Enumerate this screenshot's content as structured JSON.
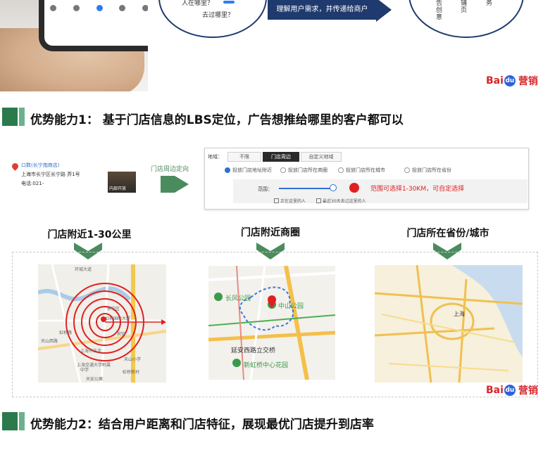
{
  "hero": {
    "bubble_left_line1": "人在哪里？",
    "bubble_left_line2": "去过哪里？",
    "arrow_text": "理解用户需求，并传递给商户",
    "bubble_right_cols": [
      "告创意",
      "铺页",
      "务"
    ]
  },
  "brand": {
    "part1": "Bai",
    "paw": "du",
    "part2": "营销"
  },
  "section1": {
    "title": "优势能力1： 基于门店信息的LBS定位，广告想推给哪里的客户都可以"
  },
  "store": {
    "name": "口数(长宁炮商店)",
    "address": "上海市长宁区长宁路      弄1号",
    "phone": "电话:021-",
    "photo_caption": "内部开放",
    "flow_label": "门店周边定向"
  },
  "panel": {
    "region_label": "地域：",
    "tabs": [
      "不限",
      "门店周边",
      "自定义地域"
    ],
    "radios": [
      "投放门店地址附近",
      "投放门店所在商圈",
      "投放门店所在城市",
      "投放门店所在省份"
    ],
    "range_label": "范围：",
    "range_note": "范围可选择1-30KM，可自定选择",
    "checks": [
      "正在这里的人",
      "最近30天去过这里的人"
    ]
  },
  "captions": [
    "门店附近1-30公里",
    "门店附近商圈",
    "门店所在省份/城市"
  ],
  "map1": {
    "labels": [
      "环城大道",
      "虹桥国际大厦",
      "长宁区",
      "宾馆",
      "上海市古北",
      "天山西路",
      "虹桥路",
      "天山小学",
      "上海交通大学附属",
      "中学",
      "虹桥新村",
      "天安公寓"
    ]
  },
  "map2": {
    "labels": [
      "长风公园",
      "中山公园",
      "延安西路立交桥",
      "新虹桥中心花园"
    ]
  },
  "map3": {
    "labels": [
      "上海"
    ]
  },
  "section2": {
    "title": "优势能力2：结合用户距离和门店特征，展现最优门店提升到店率"
  }
}
